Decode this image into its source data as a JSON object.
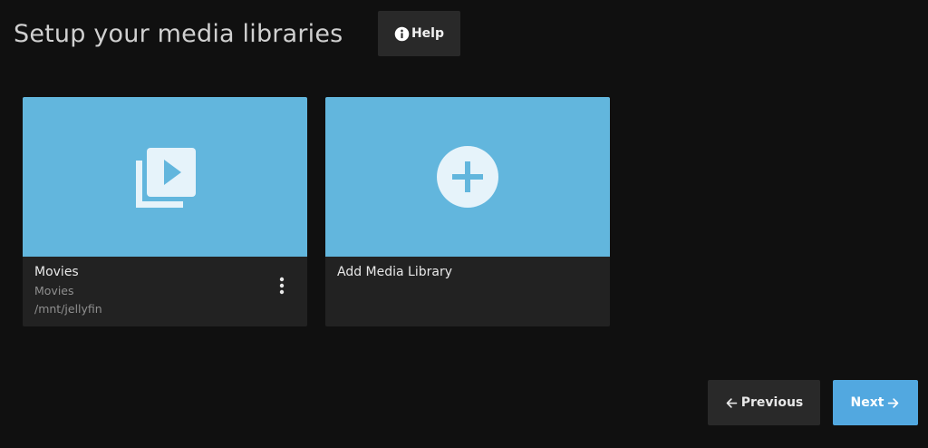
{
  "header": {
    "title": "Setup your media libraries",
    "help_label": "Help"
  },
  "libraries": [
    {
      "title": "Movies",
      "type": "Movies",
      "path": "/mnt/jellyfin",
      "icon": "video-library-icon"
    }
  ],
  "add_card": {
    "label": "Add Media Library",
    "icon": "plus-circle-icon"
  },
  "nav": {
    "previous_label": "Previous",
    "next_label": "Next"
  },
  "colors": {
    "background": "#101010",
    "card_image": "#62b6dd",
    "card_footer": "#222222",
    "button_dark": "#292929",
    "button_accent": "#52a8e0"
  }
}
